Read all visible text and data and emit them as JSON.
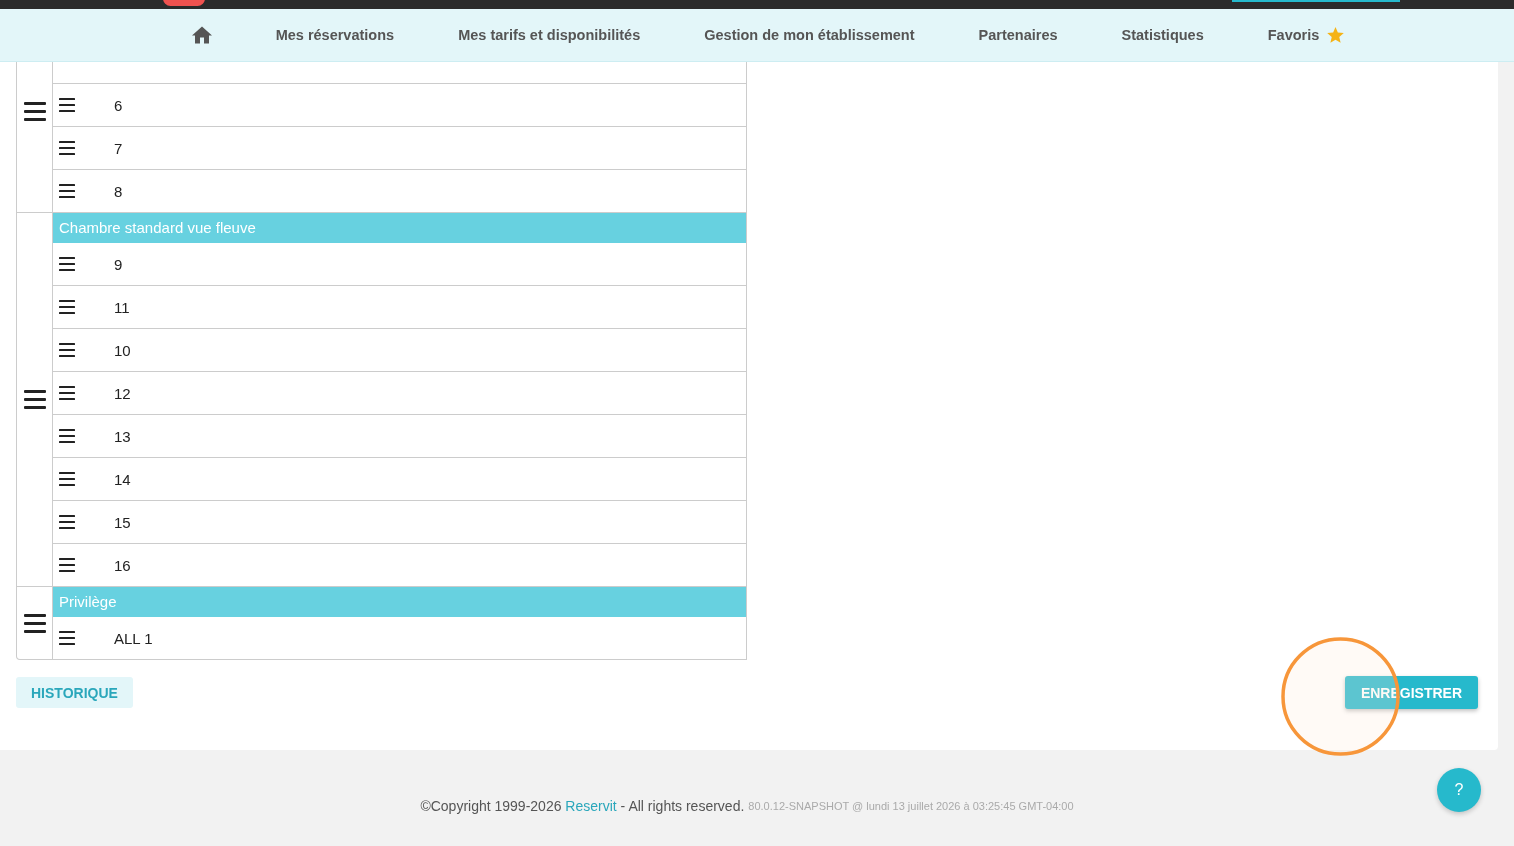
{
  "nav": {
    "items": [
      {
        "kind": "home"
      },
      {
        "kind": "link",
        "label": "Mes réservations"
      },
      {
        "kind": "link",
        "label": "Mes tarifs et disponibilités"
      },
      {
        "kind": "link",
        "label": "Gestion de mon établissement"
      },
      {
        "kind": "link",
        "label": "Partenaires"
      },
      {
        "kind": "link",
        "label": "Statistiques"
      },
      {
        "kind": "favorites",
        "label": "Favoris"
      }
    ]
  },
  "room_groups": [
    {
      "rooms": [
        "6",
        "7",
        "8"
      ]
    },
    {
      "name": "Chambre standard vue fleuve",
      "rooms": [
        "9",
        "11",
        "10",
        "12",
        "13",
        "14",
        "15",
        "16"
      ]
    },
    {
      "name": "Privilège",
      "rooms": [
        "ALL 1"
      ]
    }
  ],
  "buttons": {
    "history": "HISTORIQUE",
    "save": "ENREGISTRER"
  },
  "help_button": {
    "label": "?"
  },
  "footer": {
    "copyright": "©Copyright 1999-2026",
    "link": "Reservit",
    "rights": "- All rights reserved.",
    "version": "80.0.12-SNAPSHOT @ lundi 13 juillet 2026 à 03:25:45 GMT-04:00"
  }
}
